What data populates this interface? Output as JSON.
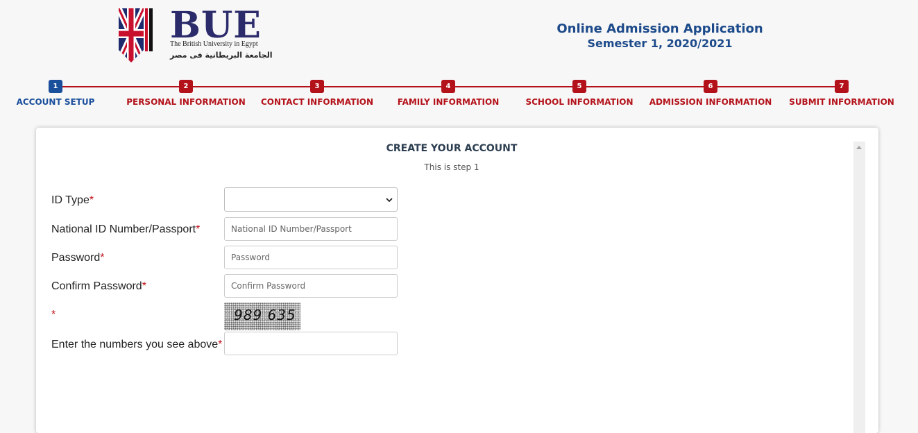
{
  "header": {
    "logo_text": "BUE",
    "logo_subtitle_en": "The British University in Egypt",
    "logo_subtitle_ar": "الجامعة البريطانية فى مصر",
    "title": "Online Admission Application",
    "subtitle": "Semester 1, 2020/2021"
  },
  "steps": [
    {
      "num": "1",
      "label": "ACCOUNT SETUP",
      "active": true
    },
    {
      "num": "2",
      "label": "PERSONAL INFORMATION",
      "active": false
    },
    {
      "num": "3",
      "label": "CONTACT INFORMATION",
      "active": false
    },
    {
      "num": "4",
      "label": "FAMILY INFORMATION",
      "active": false
    },
    {
      "num": "5",
      "label": "SCHOOL INFORMATION",
      "active": false
    },
    {
      "num": "6",
      "label": "ADMISSION INFORMATION",
      "active": false
    },
    {
      "num": "7",
      "label": "SUBMIT INFORMATION",
      "active": false
    }
  ],
  "form": {
    "title": "CREATE YOUR ACCOUNT",
    "subtitle": "This is step 1",
    "required_mark": "*",
    "id_type": {
      "label": "ID Type",
      "value": ""
    },
    "national_id": {
      "label": "National ID Number/Passport",
      "placeholder": "National ID Number/Passport",
      "value": ""
    },
    "password": {
      "label": "Password",
      "placeholder": "Password",
      "value": ""
    },
    "confirm_password": {
      "label": "Confirm Password",
      "placeholder": "Confirm Password",
      "value": ""
    },
    "captcha": {
      "label": "",
      "text": "989 635"
    },
    "captcha_input": {
      "label": "Enter the numbers you see above",
      "value": ""
    }
  },
  "colors": {
    "accent_red": "#b4121a",
    "active_blue": "#1a4f9c",
    "title_blue": "#1c4a8a",
    "logo_navy": "#2b2a6b"
  }
}
